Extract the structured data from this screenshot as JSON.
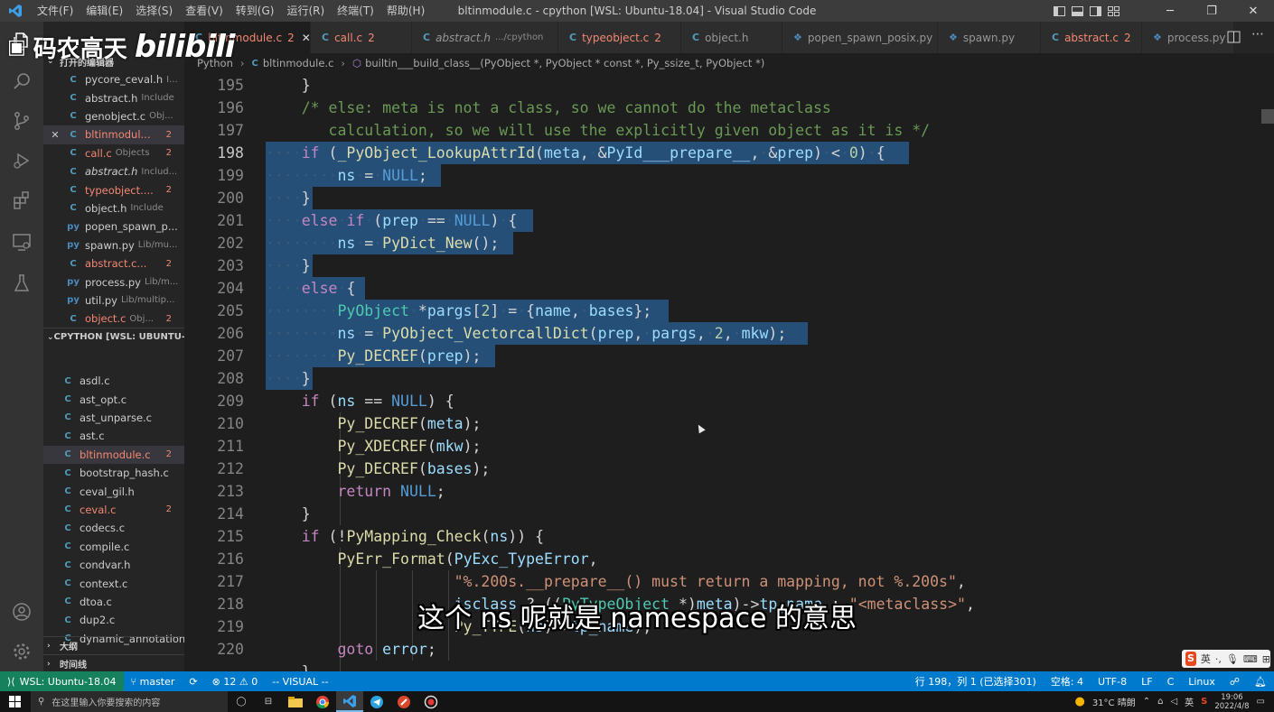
{
  "titlebar": {
    "menu": [
      "文件(F)",
      "编辑(E)",
      "选择(S)",
      "查看(V)",
      "转到(G)",
      "运行(R)",
      "终端(T)",
      "帮助(H)"
    ],
    "title": "bltinmodule.c - cpython [WSL: Ubuntu-18.04] - Visual Studio Code"
  },
  "watermark": {
    "text": "码农高天",
    "brand": "bilibili"
  },
  "sidebar": {
    "open_editors_header": "打开的编辑器",
    "open_editors": [
      {
        "icon": "C",
        "name": "pycore_ceval.h",
        "desc": "I...",
        "badge": "",
        "state": "normal"
      },
      {
        "icon": "C",
        "name": "abstract.h",
        "desc": "Include",
        "badge": "",
        "state": "normal"
      },
      {
        "icon": "C",
        "name": "genobject.c",
        "desc": "Obj...",
        "badge": "",
        "state": "normal"
      },
      {
        "icon": "C",
        "name": "bltinmodul...",
        "desc": "",
        "badge": "2",
        "state": "error-selected"
      },
      {
        "icon": "C",
        "name": "call.c",
        "desc": "Objects",
        "badge": "2",
        "state": "error"
      },
      {
        "icon": "C",
        "name": "abstract.h",
        "desc": "Includ...",
        "badge": "",
        "state": "italic"
      },
      {
        "icon": "C",
        "name": "typeobject....",
        "desc": "",
        "badge": "2",
        "state": "error"
      },
      {
        "icon": "C",
        "name": "object.h",
        "desc": "Include",
        "badge": "",
        "state": "normal"
      },
      {
        "icon": "py",
        "name": "popen_spawn_p...",
        "desc": "",
        "badge": "",
        "state": "normal"
      },
      {
        "icon": "py",
        "name": "spawn.py",
        "desc": "Lib/mu...",
        "badge": "",
        "state": "normal"
      },
      {
        "icon": "C",
        "name": "abstract.c...",
        "desc": "",
        "badge": "2",
        "state": "error"
      },
      {
        "icon": "py",
        "name": "process.py",
        "desc": "Lib/m...",
        "badge": "",
        "state": "normal"
      },
      {
        "icon": "py",
        "name": "util.py",
        "desc": "Lib/multip...",
        "badge": "",
        "state": "normal"
      },
      {
        "icon": "C",
        "name": "object.c",
        "desc": "Obj...",
        "badge": "2",
        "state": "error"
      }
    ],
    "workspace_header": "CPYTHON [WSL: UBUNTU-...",
    "workspace_files": [
      {
        "name": "asdl.c",
        "badge": "",
        "state": "normal"
      },
      {
        "name": "ast_opt.c",
        "badge": "",
        "state": "normal"
      },
      {
        "name": "ast_unparse.c",
        "badge": "",
        "state": "normal"
      },
      {
        "name": "ast.c",
        "badge": "",
        "state": "normal"
      },
      {
        "name": "bltinmodule.c",
        "badge": "2",
        "state": "error-selected"
      },
      {
        "name": "bootstrap_hash.c",
        "badge": "",
        "state": "normal"
      },
      {
        "name": "ceval_gil.h",
        "badge": "",
        "state": "normal"
      },
      {
        "name": "ceval.c",
        "badge": "2",
        "state": "error"
      },
      {
        "name": "codecs.c",
        "badge": "",
        "state": "normal"
      },
      {
        "name": "compile.c",
        "badge": "",
        "state": "normal"
      },
      {
        "name": "condvar.h",
        "badge": "",
        "state": "normal"
      },
      {
        "name": "context.c",
        "badge": "",
        "state": "normal"
      },
      {
        "name": "dtoa.c",
        "badge": "",
        "state": "normal"
      },
      {
        "name": "dup2.c",
        "badge": "",
        "state": "normal"
      },
      {
        "name": "dynamic_annotation...",
        "badge": "",
        "state": "normal"
      }
    ],
    "outline_header": "大纲",
    "timeline_header": "时间线"
  },
  "tabs": [
    {
      "name": "bltinmodule.c",
      "count": "2",
      "desc": "",
      "active": true
    },
    {
      "name": "call.c",
      "count": "2",
      "desc": "",
      "active": false
    },
    {
      "name": "abstract.h",
      "count": "",
      "desc": ".../cpython",
      "active": false
    },
    {
      "name": "typeobject.c",
      "count": "2",
      "desc": "",
      "active": false
    },
    {
      "name": "object.h",
      "count": "",
      "desc": "",
      "active": false
    },
    {
      "name": "popen_spawn_posix.py",
      "count": "",
      "desc": "",
      "active": false
    },
    {
      "name": "spawn.py",
      "count": "",
      "desc": "",
      "active": false
    },
    {
      "name": "abstract.c",
      "count": "2",
      "desc": "",
      "active": false
    },
    {
      "name": "process.py",
      "count": "",
      "desc": "",
      "active": false
    }
  ],
  "breadcrumb": [
    "Python",
    "bltinmodule.c",
    "builtin___build_class__(PyObject *, PyObject * const *, Py_ssize_t, PyObject *)"
  ],
  "editor": {
    "line_numbers": [
      "195",
      "196",
      "197",
      "198",
      "199",
      "200",
      "201",
      "202",
      "203",
      "204",
      "205",
      "206",
      "207",
      "208",
      "209",
      "210",
      "211",
      "212",
      "213",
      "214",
      "215",
      "216",
      "217",
      "218",
      "219",
      "220"
    ],
    "current_line": "198"
  },
  "statusbar": {
    "remote": "WSL: Ubuntu-18.04",
    "branch": "master",
    "problems": "⊗ 12 ⚠ 0",
    "mode": "-- VISUAL --",
    "position": "行 198，列 1 (已选择301)",
    "indent": "空格: 4",
    "encoding": "UTF-8",
    "eol": "LF",
    "language": "C",
    "platform": "Linux"
  },
  "subtitle": "这个 ns 呢就是 namespace 的意思",
  "ime": {
    "label": "英"
  },
  "taskbar": {
    "search_placeholder": "在这里输入你要搜索的内容",
    "weather": "31°C 晴朗",
    "lang": "英",
    "time": "19:06",
    "date": "2022/4/8"
  },
  "colors": {
    "accent": "#007acc",
    "remote": "#16825d",
    "selection": "#264f78",
    "error": "#f48771"
  }
}
